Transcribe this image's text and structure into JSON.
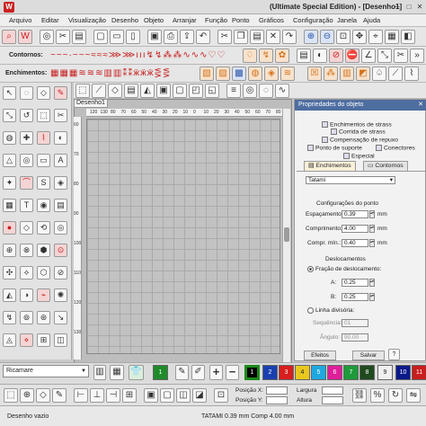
{
  "window": {
    "title": "(Ultimate Special Edition) - [Desenho1]"
  },
  "menu": [
    "Arquivo",
    "Editar",
    "Visualização",
    "Desenho",
    "Objeto",
    "Arranjar",
    "Função",
    "Ponto",
    "Gráficos",
    "Configuração",
    "Janela",
    "Ajuda"
  ],
  "toolbars": {
    "contornos_label": "Contornos:",
    "enchimentos_label": "Enchimentos:"
  },
  "document": {
    "tab": "Desenho1",
    "ruler_top": [
      "120",
      "130",
      "80",
      "70",
      "60",
      "50",
      "40",
      "30",
      "20",
      "10",
      "0",
      "10",
      "20",
      "30",
      "40",
      "50",
      "60",
      "70",
      "80"
    ],
    "ruler_left": [
      "60",
      "70",
      "80",
      "90",
      "100",
      "110",
      "120",
      "130"
    ]
  },
  "panel": {
    "title": "Propriedades do objeto",
    "tabs": [
      "Enchimentos de strass",
      "Corrida de strass",
      "Compensação de repuxo",
      "Ponto de suporte",
      "Conectores",
      "Especial"
    ],
    "active_tab": "Enchimentos",
    "other_tab": "Contornos",
    "fill_type": "Tatami",
    "stitch_config_title": "Configurações do ponto",
    "fields": [
      {
        "label": "Espaçamento:",
        "value": "0.39",
        "unit": "mm"
      },
      {
        "label": "Comprimento:",
        "value": "4.00",
        "unit": "mm"
      },
      {
        "label": "Compr. mín.:",
        "value": "0.40",
        "unit": "mm"
      }
    ],
    "displacement_title": "Deslocamentos",
    "fraction_label": "Fração de deslocamento:",
    "fraction_fields": [
      {
        "label": "A:",
        "value": "0.25"
      },
      {
        "label": "B:",
        "value": "0.25"
      }
    ],
    "line_label": "Linha divisória:",
    "sequence_label": "Sequência:",
    "sequence_value": "01",
    "angle_label": "Ângulo:",
    "angle_value": "90.00",
    "effects_button": "Efeitos",
    "save_button": "Salvar"
  },
  "colorbar": {
    "combo_value": "Ricamare",
    "swatches": [
      {
        "label": "1",
        "color": "#1f8a2a"
      },
      {
        "label": "1",
        "color": "#000000"
      },
      {
        "label": "2",
        "color": "#1a3fb0"
      },
      {
        "label": "3",
        "color": "#d81e1e"
      },
      {
        "label": "4",
        "color": "#e8c81e"
      },
      {
        "label": "5",
        "color": "#1ea8e0"
      },
      {
        "label": "6",
        "color": "#e01e9a"
      },
      {
        "label": "7",
        "color": "#1e9a3a"
      },
      {
        "label": "8",
        "color": "#1e4a1e"
      },
      {
        "label": "9",
        "color": "#f0f0f0"
      },
      {
        "label": "10",
        "color": "#0a1a8a"
      },
      {
        "label": "11",
        "color": "#c81e1e"
      }
    ]
  },
  "position": {
    "pos_x": "Posição X:",
    "pos_y": "Posição Y:",
    "width": "Largura",
    "height": "Altura"
  },
  "status": {
    "left": "Desenho vazio",
    "center": "TATAMI  0.39 mm Comp  4.00 mm"
  }
}
